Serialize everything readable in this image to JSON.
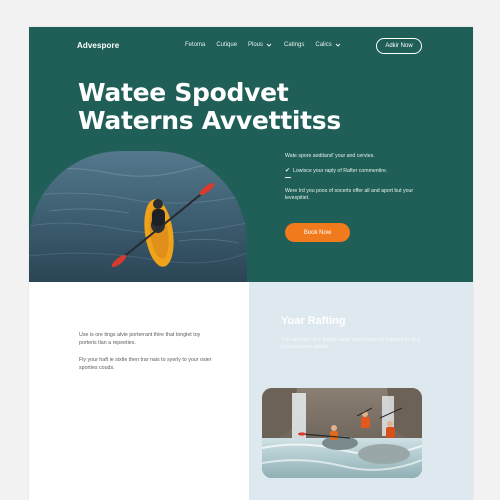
{
  "header": {
    "brand": "Advespore",
    "nav": [
      {
        "label": "Fetoma",
        "has_caret": false
      },
      {
        "label": "Cutique",
        "has_caret": false
      },
      {
        "label": "Plous",
        "has_caret": true
      },
      {
        "label": "Catings",
        "has_caret": false
      },
      {
        "label": "Calics",
        "has_caret": true
      }
    ],
    "cta": "Adkir Now"
  },
  "hero": {
    "headline_line1": "Watee Spodvet",
    "headline_line2": "Waterns Avvettitss",
    "intro": "Wate spore aoditand' your and cervies.",
    "check_item": "Lowisce your raply of Rafter commentire.",
    "body": "Were Ird you poos of socerts offer all and aport but your levespitiet.",
    "button": "Book Now"
  },
  "left_section": {
    "paragraph1": "Use is ore tings alvie porterrant thire that tonglet toy porteris tlan a repeeties.",
    "paragraph2": "Fly your haft ie sixtle then trar nais to syerly to your osier sporties couds."
  },
  "right_section": {
    "title": "Yoar Rafting",
    "text": "This arl your ofire tingiry water setowlrges no hvestes of all a youchingeran antiles"
  },
  "colors": {
    "hero_bg": "#1f5f57",
    "accent": "#f07a1c",
    "light_panel": "#dde8ef"
  }
}
